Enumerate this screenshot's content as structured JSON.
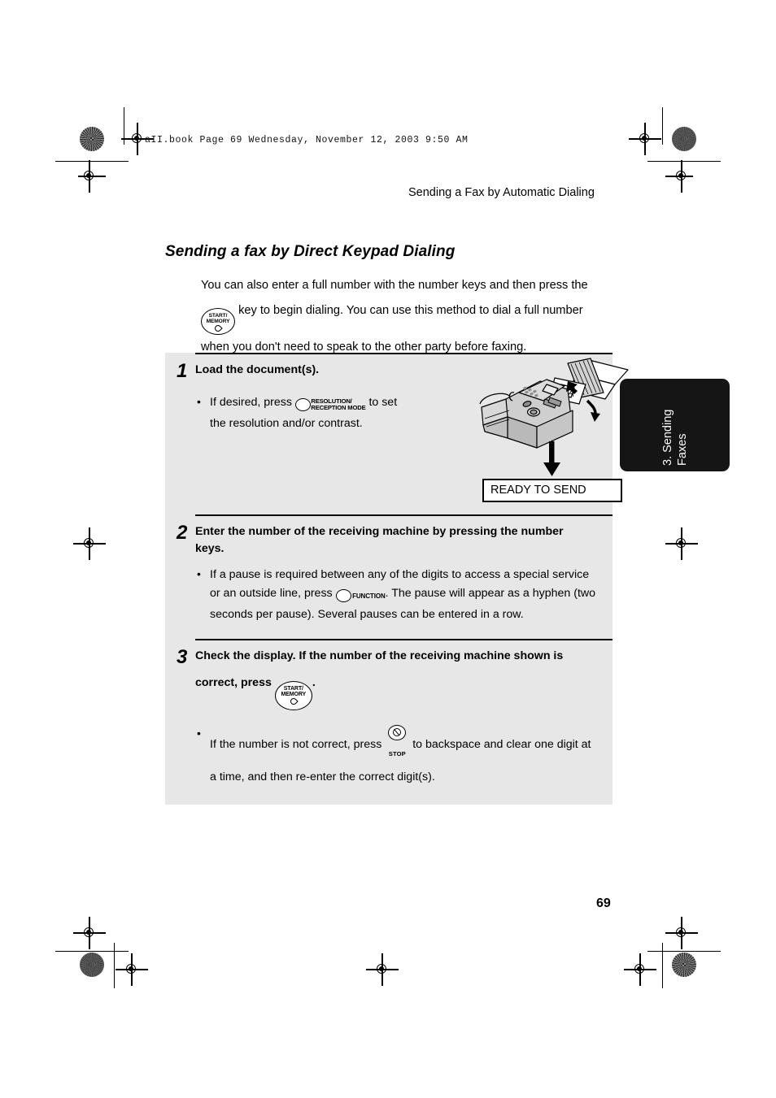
{
  "page": {
    "file_stamp": "aII.book  Page 69  Wednesday, November 12, 2003  9:50 AM",
    "running_head": "Sending a Fax by Automatic Dialing",
    "section_title": "Sending a fax by Direct Keypad Dialing",
    "page_number": "69",
    "panel_bg": "#e7e7e7",
    "tab_bg": "#151515"
  },
  "intro": {
    "line1": "You can also enter a full number with the number keys and then press the",
    "key": {
      "line1": "START/",
      "line2": "MEMORY",
      "glyph": "start-diamond"
    },
    "line2": "key to begin dialing. You can use this method to dial a full number",
    "line3": "when you don't need to speak to the other party before faxing."
  },
  "steps": [
    {
      "number": "1",
      "heading": "Load the document(s).",
      "bullet_pre": "If desired, press",
      "key": {
        "label_line1": "RESOLUTION/",
        "label_line2": "RECEPTION MODE"
      },
      "bullet_post": "to set",
      "bullet_line2": "the resolution and/or contrast.",
      "illustration": "fax-machine-loading-document",
      "display_text": "READY TO SEND"
    },
    {
      "number": "2",
      "heading_line1": "Enter the number of the receiving machine by pressing the number",
      "heading_line2": "keys.",
      "bullet_line1": "If a pause is required between any of the digits to access a special service",
      "bullet_line2_pre": "or an outside line, press",
      "key": {
        "label": "FUNCTION"
      },
      "bullet_line2_post": ". The pause will appear as a hyphen (two",
      "bullet_line3": "seconds per pause). Several pauses can be entered in a row."
    },
    {
      "number": "3",
      "heading_line1": "Check the display. If the number of the receiving machine shown is",
      "heading_line2_pre": "correct, press",
      "key": {
        "line1": "START/",
        "line2": "MEMORY",
        "glyph": "start-diamond"
      },
      "heading_line2_post": ".",
      "bullet_line1_pre": "If the number is not correct, press",
      "stop_key": {
        "caption": "STOP",
        "glyph": "stop-circle-slash"
      },
      "bullet_line1_post": "to backspace and clear one digit at",
      "bullet_line2": "a time, and then re-enter the correct digit(s)."
    }
  ],
  "side_tab": {
    "line1": "3. Sending",
    "line2": "Faxes"
  }
}
